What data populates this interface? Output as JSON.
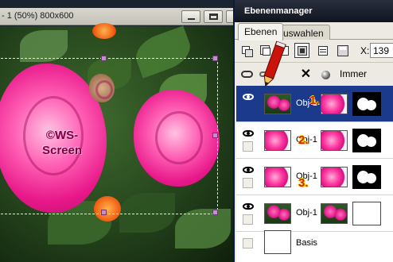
{
  "canvas": {
    "title": "- 1 (50%) 800x600",
    "watermark_line1": "©WS-",
    "watermark_line2": "Screen"
  },
  "panel": {
    "title": "Ebenenmanager",
    "tabs": [
      {
        "label": "Ebenen",
        "active": true
      },
      {
        "label": "Auswahlen",
        "active": false
      }
    ],
    "x_label": "X:",
    "x_value": "139",
    "blend_mode": "Immer"
  },
  "layers": [
    {
      "name": "Obj-1",
      "selected": true,
      "visible": true,
      "thumb": "photo",
      "mask_type": "flowers",
      "marker": "1."
    },
    {
      "name": "Obj-1",
      "selected": false,
      "visible": true,
      "thumb": "pink",
      "mask_type": "flowers",
      "marker": "2."
    },
    {
      "name": "Obj-1",
      "selected": false,
      "visible": true,
      "thumb": "pink",
      "mask_type": "flowers",
      "marker": "3."
    },
    {
      "name": "Obj-1",
      "selected": false,
      "visible": true,
      "thumb": "photo",
      "mask_type": "white",
      "marker": ""
    }
  ],
  "basis": {
    "name": "Basis"
  },
  "colors": {
    "selection": "#1b3a8c",
    "panel_bg": "#eceae2",
    "marker": "#d82000",
    "rose": "#ff3ca2"
  }
}
